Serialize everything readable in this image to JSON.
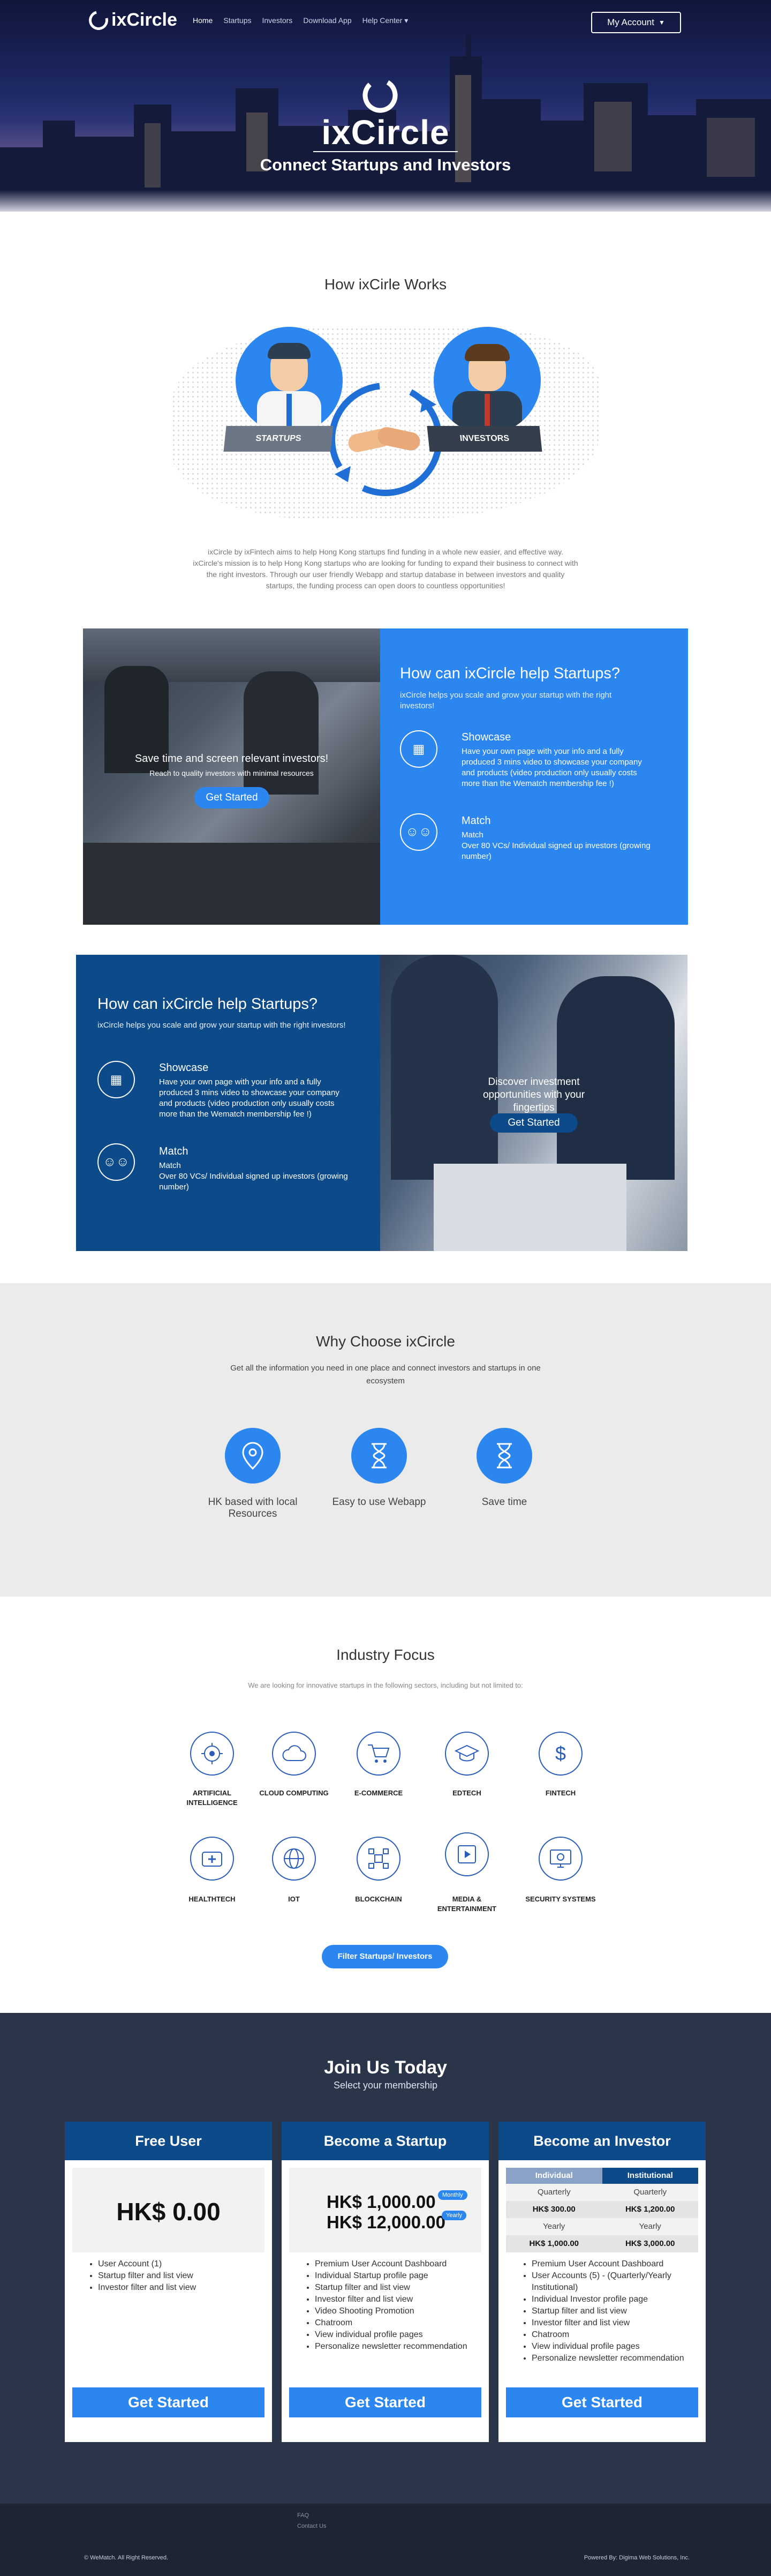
{
  "nav": {
    "logo": "ixCircle",
    "links": [
      "Home",
      "Startups",
      "Investors",
      "Download App",
      "Help Center"
    ],
    "account": "My Account"
  },
  "hero": {
    "title": "ixCircle",
    "subtitle": "Connect Startups and Investors"
  },
  "how": {
    "title": "How ixCirle Works",
    "startups_label": "STARTUPS",
    "investors_label": "INVESTORS",
    "description": "ixCircle by ixFintech aims to help Hong Kong startups find funding in a whole new easier, and effective way. ixCircle's mission is to help Hong Kong startups who are looking for funding to expand their business to connect with the right investors. Through our user friendly Webapp and startup database in between investors and quality startups, the funding process can open doors to countless opportunities!"
  },
  "panel1": {
    "overlay_title": "Save time and screen relevant investors!",
    "overlay_sub": "Reach to quality investors with minimal resources",
    "button": "Get Started",
    "title": "How can ixCircle help Startups?",
    "intro": "ixCircle helps you scale and grow your startup with the right investors!",
    "features": [
      {
        "title": "Showcase",
        "text": "Have your own page with your info and a fully produced 3 mins video to showcase your company and products (video production only usually costs more than the Wematch membership fee !)"
      },
      {
        "title": "Match",
        "text": "Match\nOver 80 VCs/ Individual signed up investors (growing number)"
      }
    ]
  },
  "panel2": {
    "title": "How can ixCircle help Startups?",
    "intro": "ixCircle helps you scale and grow your startup with the right investors!",
    "features": [
      {
        "title": "Showcase",
        "text": "Have your own page with your info and a fully produced 3 mins video to showcase your company and products (video production only usually costs more than the Wematch membership fee !)"
      },
      {
        "title": "Match",
        "text": "Match\nOver 80 VCs/ Individual signed up investors (growing number)"
      }
    ],
    "overlay_title": "Discover investment opportunities with your fingertips",
    "button": "Get Started"
  },
  "why": {
    "title": "Why Choose ixCircle",
    "subtitle": "Get all the information you need in one place and connect investors and startups in one ecosystem",
    "items": [
      "HK based with local Resources",
      "Easy to use Webapp",
      "Save time"
    ]
  },
  "industry": {
    "title": "Industry Focus",
    "subtitle": "We are looking for innovative startups in the following sectors, including but not limited to:",
    "items": [
      "ARTIFICIAL INTELLIGENCE",
      "CLOUD COMPUTING",
      "E-COMMERCE",
      "EDTECH",
      "FINTECH",
      "HEALTHTECH",
      "IOT",
      "BLOCKCHAIN",
      "MEDIA & ENTERTAINMENT",
      "SECURITY SYSTEMS"
    ],
    "button": "Filter Startups/ Investors"
  },
  "join": {
    "title": "Join Us Today",
    "subtitle": "Select your membership",
    "plans": [
      {
        "name": "Free User",
        "price": "HK$ 0.00",
        "features": [
          "User Account (1)",
          "Startup filter and list view",
          "Investor filter and list view"
        ],
        "button": "Get Started"
      },
      {
        "name": "Become a Startup",
        "price_monthly": "HK$ 1,000.00",
        "price_yearly": "HK$ 12,000.00",
        "badge_monthly": "Monthly",
        "badge_yearly": "Yearly",
        "features": [
          "Premium User Account Dashboard",
          "Individual Startup profile page",
          "Startup filter and list view",
          "Investor filter and list view",
          "Video Shooting Promotion",
          "Chatroom",
          "View individual profile pages",
          "Personalize newsletter recommendation"
        ],
        "button": "Get Started"
      },
      {
        "name": "Become an Investor",
        "tabs": [
          "Individual",
          "Institutional"
        ],
        "rows": [
          [
            "Quarterly",
            "Quarterly"
          ],
          [
            "HK$ 300.00",
            "HK$ 1,200.00"
          ],
          [
            "Yearly",
            "Yearly"
          ],
          [
            "HK$ 1,000.00",
            "HK$ 3,000.00"
          ]
        ],
        "features": [
          "Premium User Account Dashboard",
          "User Accounts (5) - (Quarterly/Yearly Institutional)",
          "Individual Investor profile page",
          "Startup filter and list view",
          "Investor filter and list view",
          "Chatroom",
          "View individual profile pages",
          "Personalize newsletter recommendation"
        ],
        "button": "Get Started"
      }
    ]
  },
  "footer": {
    "links": [
      "FAQ",
      "Contact Us"
    ],
    "copyright": "© WeMatch. All Right Reserved.",
    "powered": "Powered By: Digima Web Solutions, Inc."
  },
  "colors": {
    "accent": "#2b86ef",
    "navy": "#0c4a8a",
    "dark": "#2b3549"
  }
}
